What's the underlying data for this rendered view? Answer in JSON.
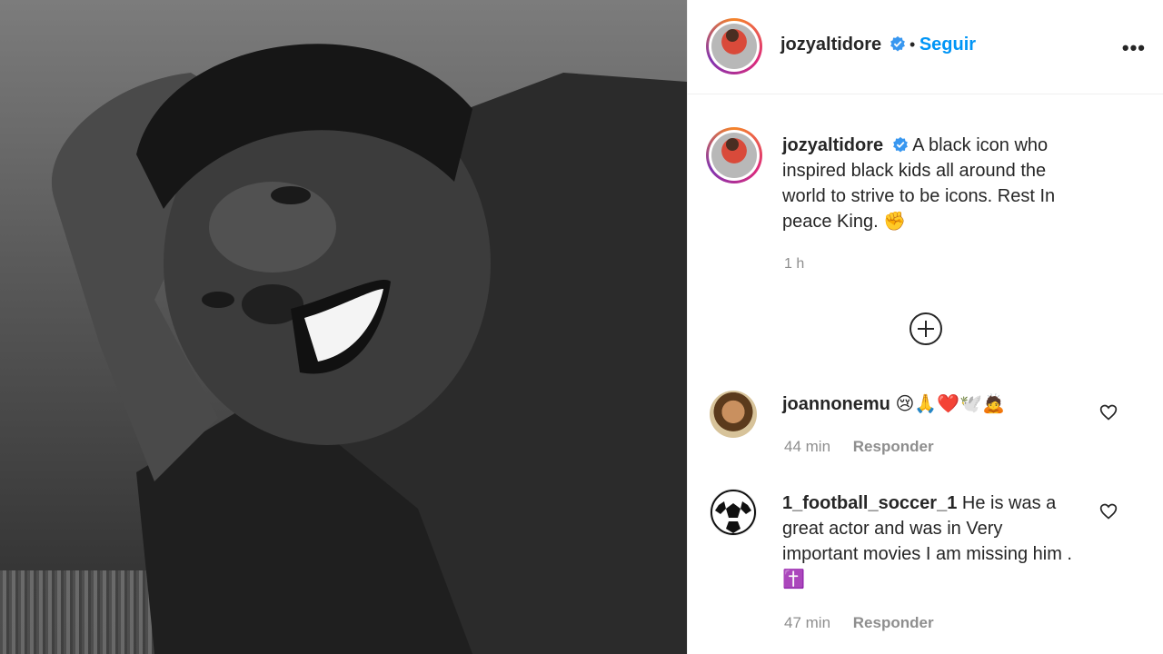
{
  "post": {
    "author": "jozyaltidore",
    "follow_separator": "•",
    "follow_label": "Seguir",
    "more_label": "•••",
    "caption_text": "A black icon who inspired black kids all around the world to strive to be icons. Rest In peace King. ✊",
    "time": "1 h"
  },
  "comments": [
    {
      "username": "joannonemu",
      "text": "😢🙏❤️🕊️🙇",
      "time": "44 min",
      "reply_label": "Responder"
    },
    {
      "username": "1_football_soccer_1",
      "text": "He is was a great actor and was in Very important movies I am missing him . ✝️",
      "time": "47 min",
      "reply_label": "Responder"
    }
  ],
  "colors": {
    "accent": "#0095f6",
    "verified": "#3897f0",
    "muted": "#8e8e8e"
  }
}
